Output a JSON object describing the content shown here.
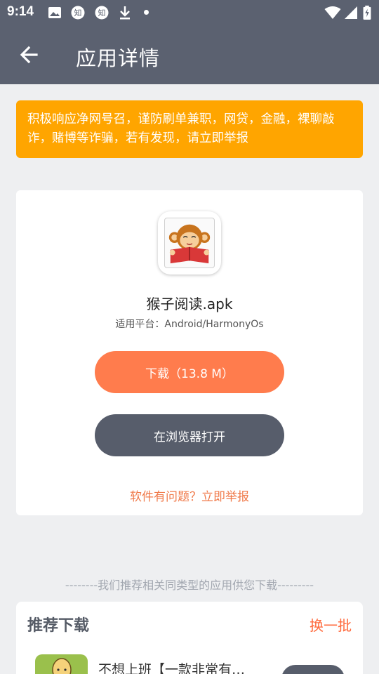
{
  "status_bar": {
    "time": "9:14",
    "left_icons": [
      "image-icon",
      "zhihu-icon",
      "zhihu-icon",
      "download-icon",
      "dot-icon"
    ],
    "right_icons": [
      "wifi-icon",
      "signal-icon",
      "battery-icon"
    ],
    "zhihu_glyph": "知"
  },
  "app_bar": {
    "title": "应用详情",
    "back_icon": "arrow-left-icon"
  },
  "warning": {
    "text": "积极响应净网号召，谨防刷单兼职，网贷，金融，裸聊敲诈，赌博等诈骗，若有发现，请立即举报",
    "color": "#ffa500"
  },
  "app": {
    "name": "猴子阅读.apk",
    "platform": "适用平台：Android/HarmonyOs",
    "icon": "monkey-reading-icon"
  },
  "actions": {
    "download_label": "下载（13.8 M）",
    "browser_label": "在浏览器打开",
    "report_label": "软件有问题？立即举报"
  },
  "recommend": {
    "divider": "--------我们推荐相关同类型的应用供您下载---------",
    "title": "推荐下载",
    "refresh_label": "换一批",
    "items": [
      {
        "name": "不想上班【一款非常有…",
        "icon": "bald-man-icon"
      }
    ]
  },
  "colors": {
    "header": "#5b6170",
    "accent": "#ff7c4d",
    "dark_button": "#575d6b",
    "warning": "#ffa500"
  }
}
